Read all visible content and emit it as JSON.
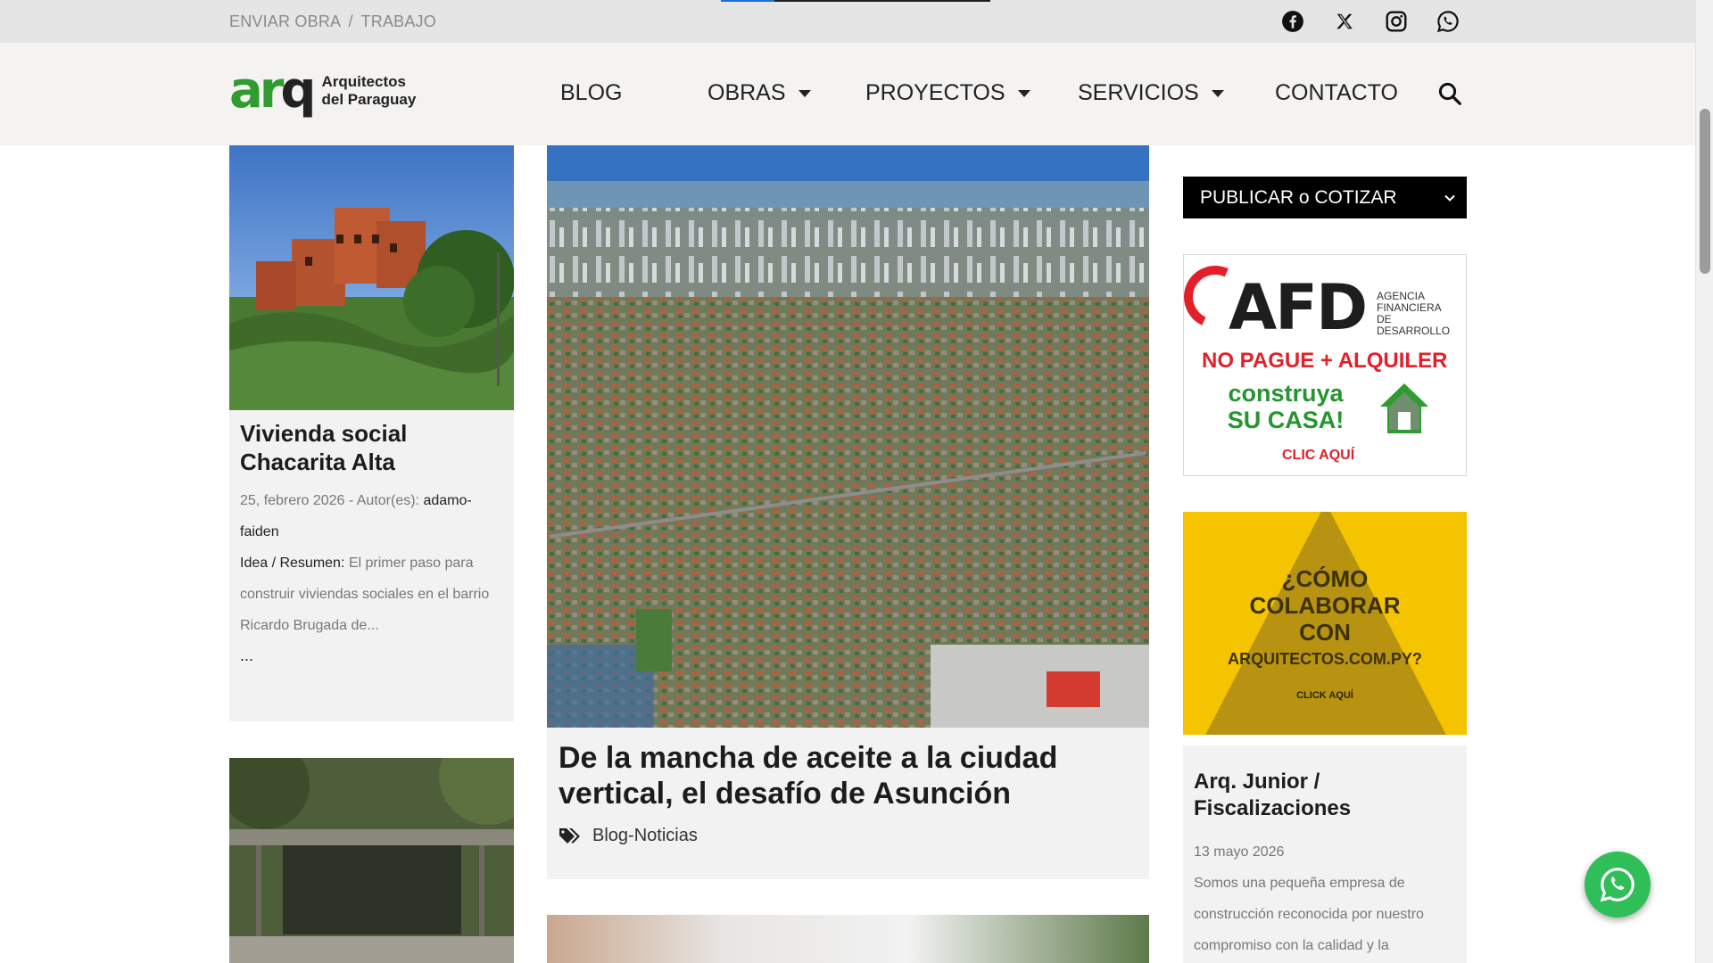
{
  "topbar": {
    "submit_work": "ENVIAR OBRA",
    "separator": "/",
    "jobs": "TRABAJO",
    "reading_progress": 0.2,
    "socials": [
      "facebook-icon",
      "x-icon",
      "instagram-icon",
      "whatsapp-icon"
    ]
  },
  "brand": {
    "logo_mark_a": "ar",
    "logo_mark_q": "q",
    "logo_text": "Arquitectos del Paraguay",
    "accent_color": "#2e9c2f"
  },
  "menu": {
    "items": [
      {
        "label": "BLOG",
        "dropdown": false
      },
      {
        "label": "OBRAS",
        "dropdown": true
      },
      {
        "label": "PROYECTOS",
        "dropdown": true
      },
      {
        "label": "SERVICIOS",
        "dropdown": true
      },
      {
        "label": "CONTACTO",
        "dropdown": false
      }
    ],
    "search_icon": "search-icon"
  },
  "posts": {
    "card1": {
      "title": "Vivienda social Chacarita Alta",
      "date": "25, febrero 2026",
      "author_prefix": " - Autor(es): ",
      "author": "adamo-faiden",
      "excerpt_label": "Idea / Resumen:",
      "excerpt": " El primer paso para construir viviendas sociales en el barrio Ricardo Brugada de...",
      "more": "..."
    },
    "feature": {
      "title": "De la mancha de aceite a la ciudad vertical, el desafío de Asunción",
      "category": "Blog-Noticias",
      "tag_icon": "tags-icon"
    }
  },
  "sidebar": {
    "select_value": "PUBLICAR o COTIZAR",
    "ad_afd": {
      "brand": "AFD",
      "agency": [
        "AGENCIA",
        "FINANCIERA",
        "DE DESARROLLO"
      ],
      "line1": "NO PAGUE + ALQUILER",
      "line2": "construya SU CASA!",
      "cta": "CLIC AQUÍ"
    },
    "ad_colab": {
      "line1": "¿CÓMO COLABORAR CON",
      "site": "ARQUITECTOS.COM.PY?",
      "cta": "CLICK AQUÍ"
    },
    "job": {
      "title": "Arq. Junior / Fiscalizaciones",
      "date": "13 mayo 2026",
      "text": "Somos una pequeña empresa de construcción reconocida por nuestro compromiso con la calidad y la"
    }
  },
  "floating": {
    "whatsapp_icon": "whatsapp-icon"
  }
}
